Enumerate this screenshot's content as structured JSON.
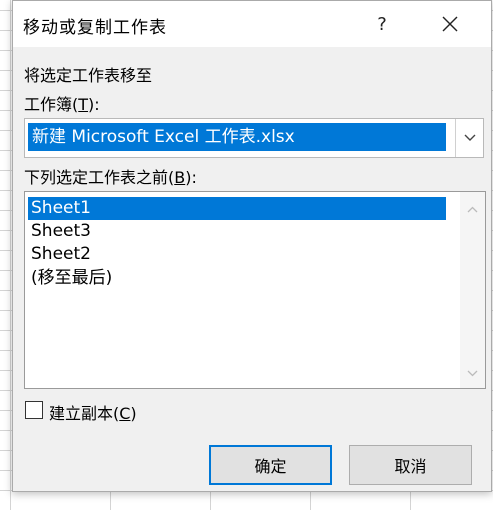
{
  "window": {
    "title": "移动或复制工作表",
    "help_glyph": "?"
  },
  "move_to_label": "将选定工作表移至",
  "workbook": {
    "label_prefix": "工作簿(",
    "label_key": "T",
    "label_suffix": "):",
    "selected_value": "新建 Microsoft Excel 工作表.xlsx"
  },
  "before_sheet": {
    "label_prefix": "下列选定工作表之前(",
    "label_key": "B",
    "label_suffix": "):",
    "items": [
      {
        "label": "Sheet1",
        "selected": true
      },
      {
        "label": "Sheet3",
        "selected": false
      },
      {
        "label": "Sheet2",
        "selected": false
      },
      {
        "label": "(移至最后)",
        "selected": false
      }
    ]
  },
  "create_copy": {
    "label_prefix": "建立副本(",
    "label_key": "C",
    "label_suffix": ")",
    "checked": false
  },
  "buttons": {
    "ok": "确定",
    "cancel": "取消"
  },
  "colors": {
    "accent": "#0078d7",
    "dialog_bg": "#f0f0f0"
  },
  "icons": [
    "close-icon",
    "chevron-down-icon",
    "scroll-up-icon",
    "scroll-down-icon"
  ]
}
